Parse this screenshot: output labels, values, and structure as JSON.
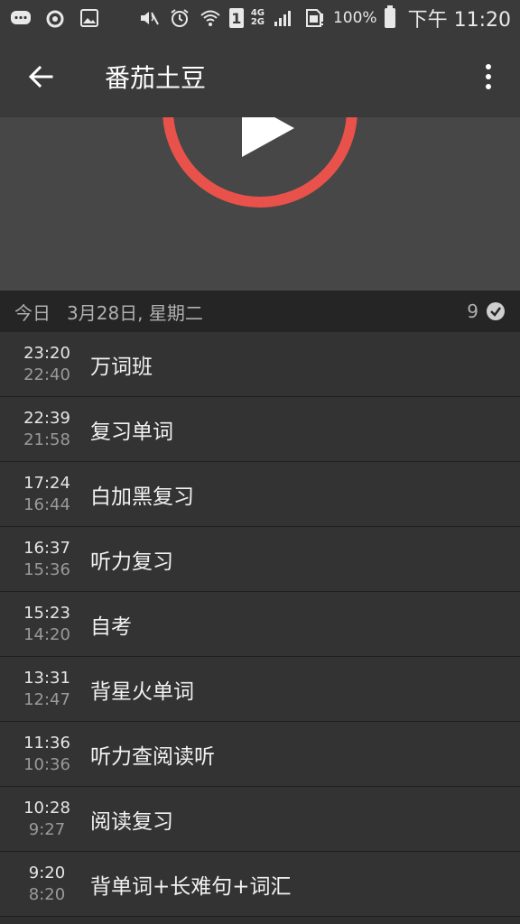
{
  "status_bar": {
    "sim_label": "1",
    "network_top": "4G",
    "network_bottom": "2G",
    "battery_text": "100%",
    "time": "下午 11:20"
  },
  "app_bar": {
    "title": "番茄土豆"
  },
  "player": {
    "accent_color": "#e8524a"
  },
  "date_header": {
    "day_label": "今日",
    "date": "3月28日, 星期二",
    "count": "9"
  },
  "items": [
    {
      "end": "23:20",
      "start": "22:40",
      "title": "万词班"
    },
    {
      "end": "22:39",
      "start": "21:58",
      "title": "复习单词"
    },
    {
      "end": "17:24",
      "start": "16:44",
      "title": "白加黑复习"
    },
    {
      "end": "16:37",
      "start": "15:36",
      "title": "听力复习"
    },
    {
      "end": "15:23",
      "start": "14:20",
      "title": "自考"
    },
    {
      "end": "13:31",
      "start": "12:47",
      "title": "背星火单词"
    },
    {
      "end": "11:36",
      "start": "10:36",
      "title": "听力查阅读听"
    },
    {
      "end": "10:28",
      "start": "9:27",
      "title": "阅读复习"
    },
    {
      "end": "9:20",
      "start": "8:20",
      "title": "背单词+长难句+词汇"
    }
  ]
}
